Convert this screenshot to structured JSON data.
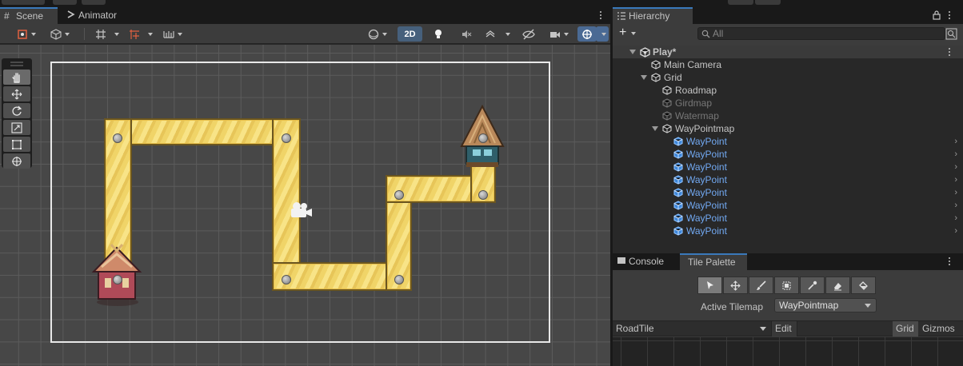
{
  "scene_panel": {
    "tabs": [
      {
        "label": "Scene",
        "icon": "grid-icon",
        "active": true
      },
      {
        "label": "Animator",
        "icon": "animator-icon",
        "active": false
      }
    ],
    "toolbar": {
      "mode_2d_label": "2D"
    }
  },
  "tools": [
    "grip-icon",
    "hand-icon",
    "move-icon",
    "rotate-icon",
    "scale-icon",
    "rect-icon",
    "transform-icon"
  ],
  "hierarchy": {
    "tab_label": "Hierarchy",
    "add_label": "+",
    "search_placeholder": "All",
    "root": "Play*",
    "items": [
      {
        "label": "Main Camera",
        "depth": 1,
        "fold": false,
        "style": "normal"
      },
      {
        "label": "Grid",
        "depth": 1,
        "fold": true,
        "style": "normal"
      },
      {
        "label": "Roadmap",
        "depth": 2,
        "fold": false,
        "style": "normal"
      },
      {
        "label": "Girdmap",
        "depth": 2,
        "fold": false,
        "style": "dim"
      },
      {
        "label": "Watermap",
        "depth": 2,
        "fold": false,
        "style": "dim"
      },
      {
        "label": "WayPointmap",
        "depth": 2,
        "fold": true,
        "style": "normal"
      },
      {
        "label": "WayPoint",
        "depth": 3,
        "fold": false,
        "style": "blue"
      },
      {
        "label": "WayPoint",
        "depth": 3,
        "fold": false,
        "style": "blue"
      },
      {
        "label": "WayPoint",
        "depth": 3,
        "fold": false,
        "style": "blue"
      },
      {
        "label": "WayPoint",
        "depth": 3,
        "fold": false,
        "style": "blue"
      },
      {
        "label": "WayPoint",
        "depth": 3,
        "fold": false,
        "style": "blue"
      },
      {
        "label": "WayPoint",
        "depth": 3,
        "fold": false,
        "style": "blue"
      },
      {
        "label": "WayPoint",
        "depth": 3,
        "fold": false,
        "style": "blue"
      },
      {
        "label": "WayPoint",
        "depth": 3,
        "fold": false,
        "style": "blue"
      }
    ]
  },
  "bottom_panel": {
    "tabs": [
      {
        "label": "Console",
        "icon": "console-icon",
        "active": false
      },
      {
        "label": "Tile Palette",
        "active": true
      }
    ],
    "palette_tools": [
      "select-icon",
      "move-icon",
      "paint-brush-icon",
      "box-fill-icon",
      "picker-icon",
      "eraser-icon",
      "fill-bucket-icon"
    ],
    "active_tilemap_label": "Active Tilemap",
    "active_tilemap_value": "WayPointmap",
    "palette_name": "RoadTile",
    "edit_label": "Edit",
    "grid_label": "Grid",
    "gizmos_label": "Gizmos"
  },
  "colors": {
    "accent": "#3a79bb",
    "road": "#f0d468",
    "waypoint_label": "#72a9f2"
  }
}
